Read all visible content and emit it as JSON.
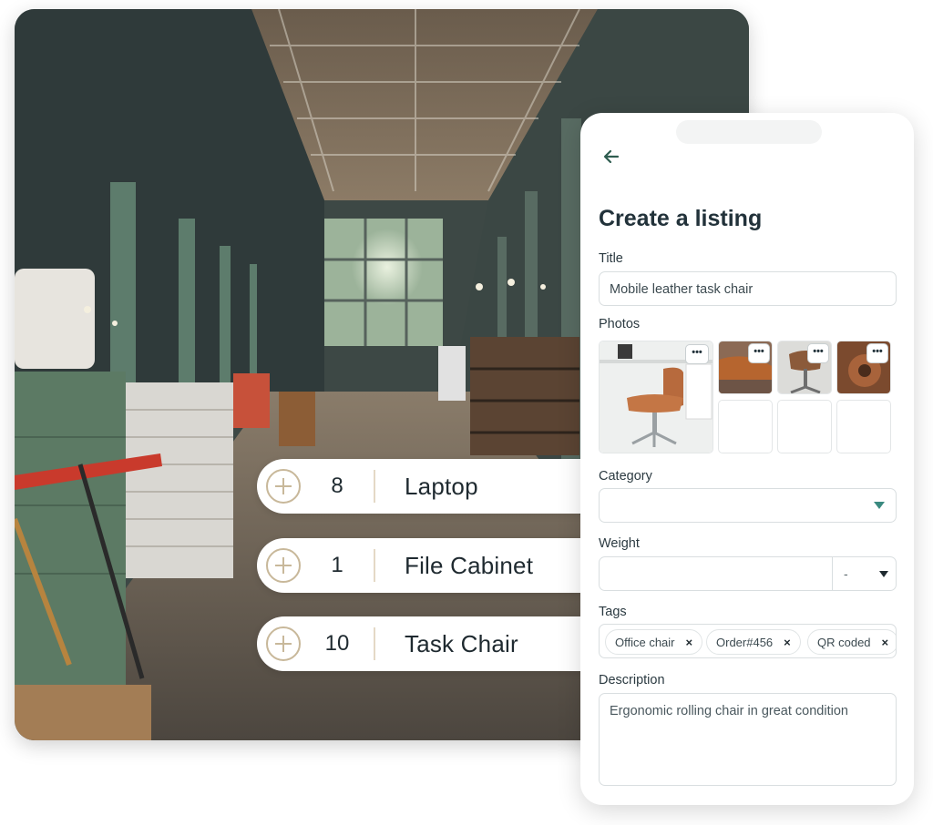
{
  "inventory": [
    {
      "qty": "8",
      "name": "Laptop"
    },
    {
      "qty": "1",
      "name": "File Cabinet"
    },
    {
      "qty": "10",
      "name": "Task Chair"
    }
  ],
  "listing": {
    "heading": "Create a listing",
    "title_label": "Title",
    "title_value": "Mobile leather task chair",
    "photos_label": "Photos",
    "category_label": "Category",
    "category_value": "",
    "weight_label": "Weight",
    "weight_value": "",
    "weight_unit": "-",
    "tags_label": "Tags",
    "tags": [
      "Office chair",
      "Order#456",
      "QR coded"
    ],
    "description_label": "Description",
    "description_value": "Ergonomic rolling chair in great condition",
    "more_glyph": "•••",
    "remove_glyph": "×"
  },
  "colors": {
    "accent": "#3b8a80",
    "back_arrow": "#2f5d50",
    "pill_accent": "#c8b89a"
  }
}
